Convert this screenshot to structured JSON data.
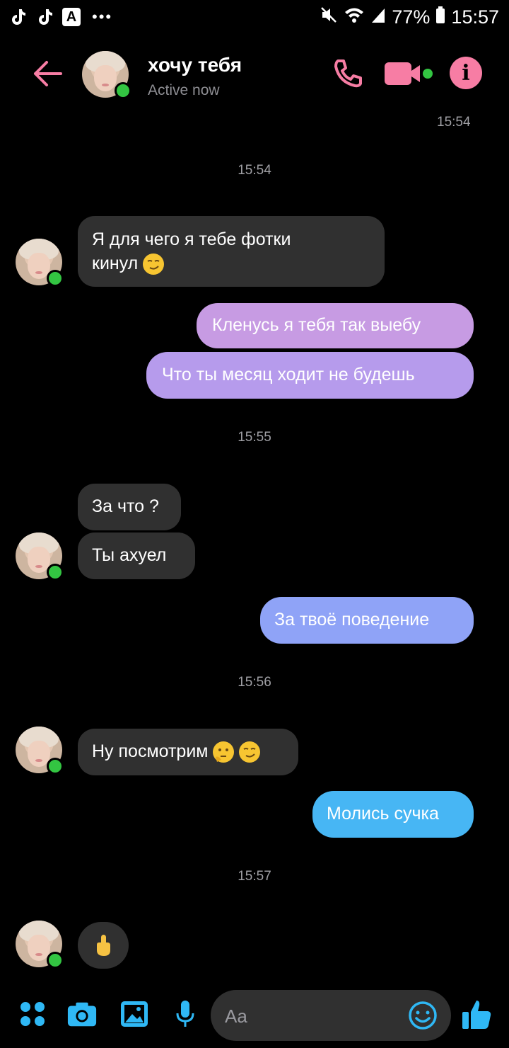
{
  "status_bar": {
    "battery": "77%",
    "time": "15:57",
    "left_icons": [
      "tiktok-icon",
      "tiktok-icon",
      "a-app-icon",
      "more-dots-icon"
    ],
    "right_icons": [
      "mute-icon",
      "wifi-icon",
      "signal-icon",
      "battery-icon"
    ]
  },
  "header": {
    "title": "хочу тебя",
    "subtitle": "Active now"
  },
  "colors": {
    "accent_pink": "#f77da4",
    "online_green": "#33c542",
    "bubble_incoming": "#303030",
    "bubble_out_purple": "#c79be3",
    "bubble_out_lavender": "#b09bf0",
    "bubble_out_blue": "#8fa3f7",
    "bubble_out_cyan": "#47b6f4",
    "icon_blue": "#2fb8f5"
  },
  "timestamps": {
    "t1": "15:54",
    "t2": "15:54",
    "t3": "15:55",
    "t4": "15:56",
    "t5": "15:57"
  },
  "messages": [
    {
      "direction": "incoming",
      "text": "Я для чего я тебе фотки",
      "text2": "кинул",
      "emoji": [
        "smirk-emoji"
      ]
    },
    {
      "direction": "outgoing",
      "text": "Кленусь я тебя так выебу"
    },
    {
      "direction": "outgoing",
      "text": "Что ты месяц ходит не будешь"
    },
    {
      "direction": "incoming",
      "text": "За что ?"
    },
    {
      "direction": "incoming",
      "text": "Ты ахуел"
    },
    {
      "direction": "outgoing",
      "text": "За твоё поведение"
    },
    {
      "direction": "incoming",
      "text": "Ну посмотрим",
      "emoji": [
        "thinking-emoji",
        "smirk-emoji"
      ]
    },
    {
      "direction": "outgoing",
      "text": "Молись сучка"
    },
    {
      "direction": "incoming",
      "text": "",
      "emoji": [
        "middle-finger-emoji"
      ]
    }
  ],
  "composer": {
    "placeholder": "Aa"
  }
}
